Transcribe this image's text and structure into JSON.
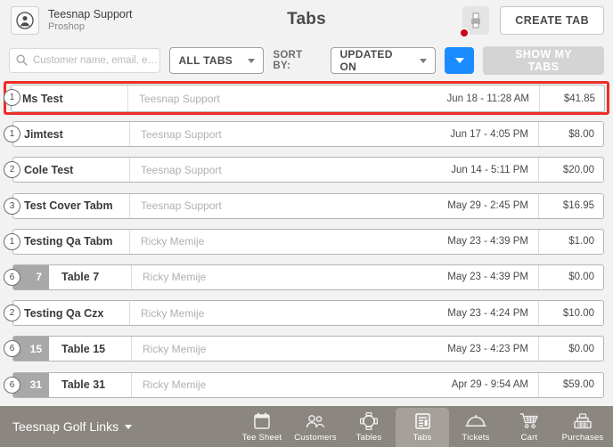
{
  "header": {
    "user_name": "Teesnap Support",
    "user_role": "Proshop",
    "title": "Tabs",
    "create_tab_label": "CREATE TAB",
    "device_icon": "printer-icon",
    "avatar_icon": "user-avatar-icon"
  },
  "filters": {
    "search_placeholder": "Customer name, email, e…",
    "search_value": "",
    "search_icon": "search-icon",
    "tabs_filter_value": "ALL TABS",
    "tabs_filter_options": [
      "ALL TABS"
    ],
    "sort_by_label": "SORT BY:",
    "sort_value": "UPDATED ON",
    "sort_options": [
      "UPDATED ON"
    ],
    "sort_direction_icon": "chevron-down-icon",
    "show_my_tabs_label": "SHOW MY TABS"
  },
  "list": {
    "rows": [
      {
        "count": "1",
        "table": "",
        "name": "Ms Test",
        "owner": "Teesnap Support",
        "date": "Jun 18 - 11:28 AM",
        "amount": "$41.85",
        "selected": true
      },
      {
        "count": "1",
        "table": "",
        "name": "Jimtest",
        "owner": "Teesnap Support",
        "date": "Jun 17 - 4:05 PM",
        "amount": "$8.00",
        "selected": false
      },
      {
        "count": "2",
        "table": "",
        "name": "Cole Test",
        "owner": "Teesnap Support",
        "date": "Jun 14 - 5:11 PM",
        "amount": "$20.00",
        "selected": false
      },
      {
        "count": "3",
        "table": "",
        "name": "Test Cover Tabm",
        "owner": "Teesnap Support",
        "date": "May 29 - 2:45 PM",
        "amount": "$16.95",
        "selected": false
      },
      {
        "count": "1",
        "table": "",
        "name": "Testing Qa Tabm",
        "owner": "Ricky Memije",
        "date": "May 23 - 4:39 PM",
        "amount": "$1.00",
        "selected": false
      },
      {
        "count": "6",
        "table": "7",
        "name": "Table 7",
        "owner": "Ricky Memije",
        "date": "May 23 - 4:39 PM",
        "amount": "$0.00",
        "selected": false
      },
      {
        "count": "2",
        "table": "",
        "name": "Testing Qa Czx",
        "owner": "Ricky Memije",
        "date": "May 23 - 4:24 PM",
        "amount": "$10.00",
        "selected": false
      },
      {
        "count": "6",
        "table": "15",
        "name": "Table 15",
        "owner": "Ricky Memije",
        "date": "May 23 - 4:23 PM",
        "amount": "$0.00",
        "selected": false
      },
      {
        "count": "6",
        "table": "31",
        "name": "Table 31",
        "owner": "Ricky Memije",
        "date": "Apr 29 - 9:54 AM",
        "amount": "$59.00",
        "selected": false
      }
    ]
  },
  "bottom_nav": {
    "course_name": "Teesnap Golf Links",
    "course_caret_icon": "caret-down-icon",
    "items": [
      {
        "label": "Tee Sheet",
        "icon": "calendar-icon",
        "active": false
      },
      {
        "label": "Customers",
        "icon": "people-icon",
        "active": false
      },
      {
        "label": "Tables",
        "icon": "table-icon",
        "active": false
      },
      {
        "label": "Tabs",
        "icon": "receipt-icon",
        "active": true
      },
      {
        "label": "Tickets",
        "icon": "dome-icon",
        "active": false
      },
      {
        "label": "Cart",
        "icon": "cart-icon",
        "active": false
      },
      {
        "label": "Purchases",
        "icon": "register-icon",
        "active": false
      }
    ]
  },
  "colors": {
    "accent_blue": "#1a8cff",
    "selection_red": "#ee2d24",
    "badge_red": "#d0021b",
    "nav_bar": "#8b8780",
    "page_bg": "#f2f2f2"
  }
}
